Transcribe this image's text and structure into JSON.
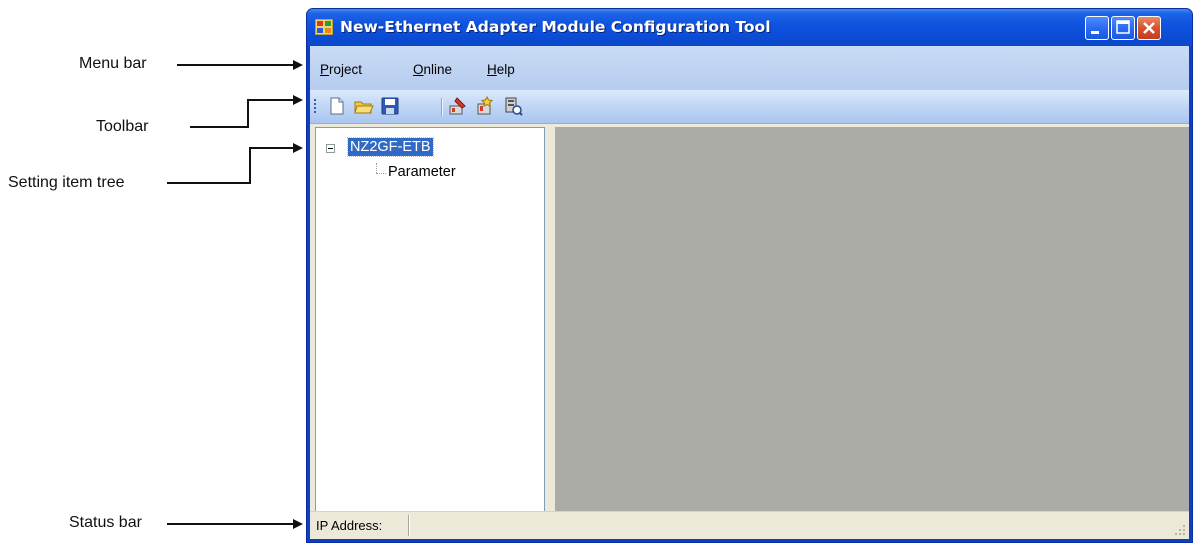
{
  "annotations": {
    "menu_bar": "Menu bar",
    "toolbar": "Toolbar",
    "setting_item_tree": "Setting item tree",
    "status_bar": "Status bar"
  },
  "window": {
    "title": "New-Ethernet Adapter Module Configuration Tool"
  },
  "menu": {
    "items": [
      {
        "label": "Project",
        "accelerator": "P"
      },
      {
        "label": "Online",
        "accelerator": "O"
      },
      {
        "label": "Help",
        "accelerator": "H"
      }
    ]
  },
  "toolbar": {
    "icons": [
      "new-icon",
      "open-icon",
      "save-icon",
      "write-icon",
      "read-icon",
      "monitor-icon"
    ]
  },
  "tree": {
    "root": "NZ2GF-ETB",
    "children": [
      "Parameter"
    ]
  },
  "statusbar": {
    "ip_label": "IP Address:"
  },
  "colors": {
    "titlebar": "#0a4cd6",
    "menubar": "#c9dbf5",
    "selection": "#316ac5",
    "content_bg": "#abaca6",
    "close_button": "#d6522f"
  }
}
